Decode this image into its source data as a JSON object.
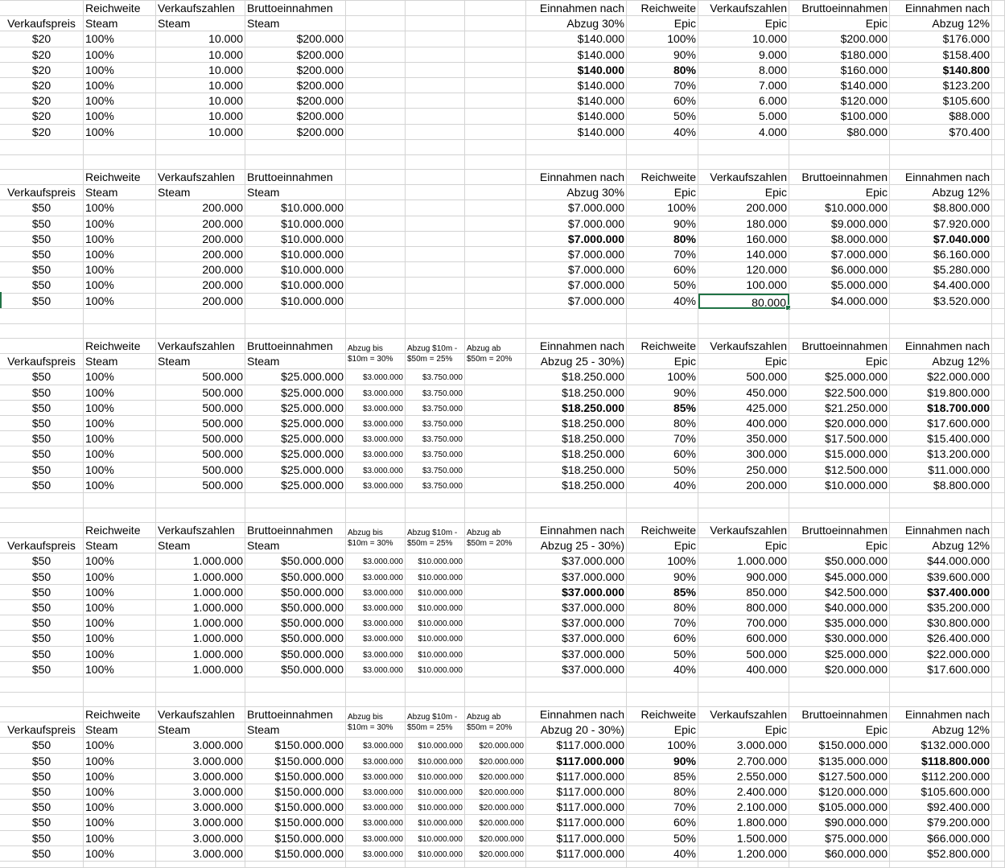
{
  "sheet": {
    "blocks": [
      {
        "header1": [
          "",
          "Reichweite",
          "Verkaufszahlen",
          "Bruttoeinnahmen",
          "",
          "",
          "",
          "Einnahmen nach",
          "Reichweite",
          "Verkaufszahlen",
          "Bruttoeinnahmen",
          "Einnahmen nach"
        ],
        "header2": [
          "Verkaufspreis",
          "Steam",
          "Steam",
          "Steam",
          "",
          "",
          "",
          "Abzug 30%",
          "Epic",
          "Epic",
          "Epic",
          "Abzug 12%"
        ],
        "rows": [
          [
            "$20",
            "100%",
            "10.000",
            "$200.000",
            "",
            "",
            "",
            "$140.000",
            "100%",
            "10.000",
            "$200.000",
            "$176.000"
          ],
          [
            "$20",
            "100%",
            "10.000",
            "$200.000",
            "",
            "",
            "",
            "$140.000",
            "90%",
            "9.000",
            "$180.000",
            "$158.400"
          ],
          [
            "$20",
            "100%",
            "10.000",
            "$200.000",
            "",
            "",
            "",
            "$140.000",
            "80%",
            "8.000",
            "$160.000",
            "$140.800"
          ],
          [
            "$20",
            "100%",
            "10.000",
            "$200.000",
            "",
            "",
            "",
            "$140.000",
            "70%",
            "7.000",
            "$140.000",
            "$123.200"
          ],
          [
            "$20",
            "100%",
            "10.000",
            "$200.000",
            "",
            "",
            "",
            "$140.000",
            "60%",
            "6.000",
            "$120.000",
            "$105.600"
          ],
          [
            "$20",
            "100%",
            "10.000",
            "$200.000",
            "",
            "",
            "",
            "$140.000",
            "50%",
            "5.000",
            "$100.000",
            "$88.000"
          ],
          [
            "$20",
            "100%",
            "10.000",
            "$200.000",
            "",
            "",
            "",
            "$140.000",
            "40%",
            "4.000",
            "$80.000",
            "$70.400"
          ]
        ]
      },
      {
        "header1": [
          "",
          "Reichweite",
          "Verkaufszahlen",
          "Bruttoeinnahmen",
          "",
          "",
          "",
          "Einnahmen nach",
          "Reichweite",
          "Verkaufszahlen",
          "Bruttoeinnahmen",
          "Einnahmen nach"
        ],
        "header2": [
          "Verkaufspreis",
          "Steam",
          "Steam",
          "Steam",
          "",
          "",
          "",
          "Abzug 30%",
          "Epic",
          "Epic",
          "Epic",
          "Abzug 12%"
        ],
        "rows": [
          [
            "$50",
            "100%",
            "200.000",
            "$10.000.000",
            "",
            "",
            "",
            "$7.000.000",
            "100%",
            "200.000",
            "$10.000.000",
            "$8.800.000"
          ],
          [
            "$50",
            "100%",
            "200.000",
            "$10.000.000",
            "",
            "",
            "",
            "$7.000.000",
            "90%",
            "180.000",
            "$9.000.000",
            "$7.920.000"
          ],
          [
            "$50",
            "100%",
            "200.000",
            "$10.000.000",
            "",
            "",
            "",
            "$7.000.000",
            "80%",
            "160.000",
            "$8.000.000",
            "$7.040.000"
          ],
          [
            "$50",
            "100%",
            "200.000",
            "$10.000.000",
            "",
            "",
            "",
            "$7.000.000",
            "70%",
            "140.000",
            "$7.000.000",
            "$6.160.000"
          ],
          [
            "$50",
            "100%",
            "200.000",
            "$10.000.000",
            "",
            "",
            "",
            "$7.000.000",
            "60%",
            "120.000",
            "$6.000.000",
            "$5.280.000"
          ],
          [
            "$50",
            "100%",
            "200.000",
            "$10.000.000",
            "",
            "",
            "",
            "$7.000.000",
            "50%",
            "100.000",
            "$5.000.000",
            "$4.400.000"
          ],
          [
            "$50",
            "100%",
            "200.000",
            "$10.000.000",
            "",
            "",
            "",
            "$7.000.000",
            "40%",
            "80.000",
            "$4.000.000",
            "$3.520.000"
          ]
        ]
      },
      {
        "header1": [
          "",
          "Reichweite",
          "Verkaufszahlen",
          "Bruttoeinnahmen",
          "Abzug bis",
          "Abzug $10m -",
          "Abzug ab",
          "Einnahmen nach",
          "Reichweite",
          "Verkaufszahlen",
          "Bruttoeinnahmen",
          "Einnahmen nach"
        ],
        "header2": [
          "Verkaufspreis",
          "Steam",
          "Steam",
          "Steam",
          "$10m = 30%",
          "$50m = 25%",
          "$50m = 20%",
          "Abzug 25 - 30%)",
          "Epic",
          "Epic",
          "Epic",
          "Abzug 12%"
        ],
        "rows": [
          [
            "$50",
            "100%",
            "500.000",
            "$25.000.000",
            "$3.000.000",
            "$3.750.000",
            "",
            "$18.250.000",
            "100%",
            "500.000",
            "$25.000.000",
            "$22.000.000"
          ],
          [
            "$50",
            "100%",
            "500.000",
            "$25.000.000",
            "$3.000.000",
            "$3.750.000",
            "",
            "$18.250.000",
            "90%",
            "450.000",
            "$22.500.000",
            "$19.800.000"
          ],
          [
            "$50",
            "100%",
            "500.000",
            "$25.000.000",
            "$3.000.000",
            "$3.750.000",
            "",
            "$18.250.000",
            "85%",
            "425.000",
            "$21.250.000",
            "$18.700.000"
          ],
          [
            "$50",
            "100%",
            "500.000",
            "$25.000.000",
            "$3.000.000",
            "$3.750.000",
            "",
            "$18.250.000",
            "80%",
            "400.000",
            "$20.000.000",
            "$17.600.000"
          ],
          [
            "$50",
            "100%",
            "500.000",
            "$25.000.000",
            "$3.000.000",
            "$3.750.000",
            "",
            "$18.250.000",
            "70%",
            "350.000",
            "$17.500.000",
            "$15.400.000"
          ],
          [
            "$50",
            "100%",
            "500.000",
            "$25.000.000",
            "$3.000.000",
            "$3.750.000",
            "",
            "$18.250.000",
            "60%",
            "300.000",
            "$15.000.000",
            "$13.200.000"
          ],
          [
            "$50",
            "100%",
            "500.000",
            "$25.000.000",
            "$3.000.000",
            "$3.750.000",
            "",
            "$18.250.000",
            "50%",
            "250.000",
            "$12.500.000",
            "$11.000.000"
          ],
          [
            "$50",
            "100%",
            "500.000",
            "$25.000.000",
            "$3.000.000",
            "$3.750.000",
            "",
            "$18.250.000",
            "40%",
            "200.000",
            "$10.000.000",
            "$8.800.000"
          ]
        ]
      },
      {
        "header1": [
          "",
          "Reichweite",
          "Verkaufszahlen",
          "Bruttoeinnahmen",
          "Abzug bis",
          "Abzug $10m -",
          "Abzug ab",
          "Einnahmen nach",
          "Reichweite",
          "Verkaufszahlen",
          "Bruttoeinnahmen",
          "Einnahmen nach"
        ],
        "header2": [
          "Verkaufspreis",
          "Steam",
          "Steam",
          "Steam",
          "$10m = 30%",
          "$50m = 25%",
          "$50m = 20%",
          "Abzug 25 - 30%)",
          "Epic",
          "Epic",
          "Epic",
          "Abzug 12%"
        ],
        "rows": [
          [
            "$50",
            "100%",
            "1.000.000",
            "$50.000.000",
            "$3.000.000",
            "$10.000.000",
            "",
            "$37.000.000",
            "100%",
            "1.000.000",
            "$50.000.000",
            "$44.000.000"
          ],
          [
            "$50",
            "100%",
            "1.000.000",
            "$50.000.000",
            "$3.000.000",
            "$10.000.000",
            "",
            "$37.000.000",
            "90%",
            "900.000",
            "$45.000.000",
            "$39.600.000"
          ],
          [
            "$50",
            "100%",
            "1.000.000",
            "$50.000.000",
            "$3.000.000",
            "$10.000.000",
            "",
            "$37.000.000",
            "85%",
            "850.000",
            "$42.500.000",
            "$37.400.000"
          ],
          [
            "$50",
            "100%",
            "1.000.000",
            "$50.000.000",
            "$3.000.000",
            "$10.000.000",
            "",
            "$37.000.000",
            "80%",
            "800.000",
            "$40.000.000",
            "$35.200.000"
          ],
          [
            "$50",
            "100%",
            "1.000.000",
            "$50.000.000",
            "$3.000.000",
            "$10.000.000",
            "",
            "$37.000.000",
            "70%",
            "700.000",
            "$35.000.000",
            "$30.800.000"
          ],
          [
            "$50",
            "100%",
            "1.000.000",
            "$50.000.000",
            "$3.000.000",
            "$10.000.000",
            "",
            "$37.000.000",
            "60%",
            "600.000",
            "$30.000.000",
            "$26.400.000"
          ],
          [
            "$50",
            "100%",
            "1.000.000",
            "$50.000.000",
            "$3.000.000",
            "$10.000.000",
            "",
            "$37.000.000",
            "50%",
            "500.000",
            "$25.000.000",
            "$22.000.000"
          ],
          [
            "$50",
            "100%",
            "1.000.000",
            "$50.000.000",
            "$3.000.000",
            "$10.000.000",
            "",
            "$37.000.000",
            "40%",
            "400.000",
            "$20.000.000",
            "$17.600.000"
          ]
        ]
      },
      {
        "header1": [
          "",
          "Reichweite",
          "Verkaufszahlen",
          "Bruttoeinnahmen",
          "Abzug bis",
          "Abzug $10m -",
          "Abzug ab",
          "Einnahmen nach",
          "Reichweite",
          "Verkaufszahlen",
          "Bruttoeinnahmen",
          "Einnahmen nach"
        ],
        "header2": [
          "Verkaufspreis",
          "Steam",
          "Steam",
          "Steam",
          "$10m = 30%",
          "$50m = 25%",
          "$50m = 20%",
          "Abzug 20 - 30%)",
          "Epic",
          "Epic",
          "Epic",
          "Abzug 12%"
        ],
        "rows": [
          [
            "$50",
            "100%",
            "3.000.000",
            "$150.000.000",
            "$3.000.000",
            "$10.000.000",
            "$20.000.000",
            "$117.000.000",
            "100%",
            "3.000.000",
            "$150.000.000",
            "$132.000.000"
          ],
          [
            "$50",
            "100%",
            "3.000.000",
            "$150.000.000",
            "$3.000.000",
            "$10.000.000",
            "$20.000.000",
            "$117.000.000",
            "90%",
            "2.700.000",
            "$135.000.000",
            "$118.800.000"
          ],
          [
            "$50",
            "100%",
            "3.000.000",
            "$150.000.000",
            "$3.000.000",
            "$10.000.000",
            "$20.000.000",
            "$117.000.000",
            "85%",
            "2.550.000",
            "$127.500.000",
            "$112.200.000"
          ],
          [
            "$50",
            "100%",
            "3.000.000",
            "$150.000.000",
            "$3.000.000",
            "$10.000.000",
            "$20.000.000",
            "$117.000.000",
            "80%",
            "2.400.000",
            "$120.000.000",
            "$105.600.000"
          ],
          [
            "$50",
            "100%",
            "3.000.000",
            "$150.000.000",
            "$3.000.000",
            "$10.000.000",
            "$20.000.000",
            "$117.000.000",
            "70%",
            "2.100.000",
            "$105.000.000",
            "$92.400.000"
          ],
          [
            "$50",
            "100%",
            "3.000.000",
            "$150.000.000",
            "$3.000.000",
            "$10.000.000",
            "$20.000.000",
            "$117.000.000",
            "60%",
            "1.800.000",
            "$90.000.000",
            "$79.200.000"
          ],
          [
            "$50",
            "100%",
            "3.000.000",
            "$150.000.000",
            "$3.000.000",
            "$10.000.000",
            "$20.000.000",
            "$117.000.000",
            "50%",
            "1.500.000",
            "$75.000.000",
            "$66.000.000"
          ],
          [
            "$50",
            "100%",
            "3.000.000",
            "$150.000.000",
            "$3.000.000",
            "$10.000.000",
            "$20.000.000",
            "$117.000.000",
            "40%",
            "1.200.000",
            "$60.000.000",
            "$52.800.000"
          ]
        ]
      }
    ]
  }
}
